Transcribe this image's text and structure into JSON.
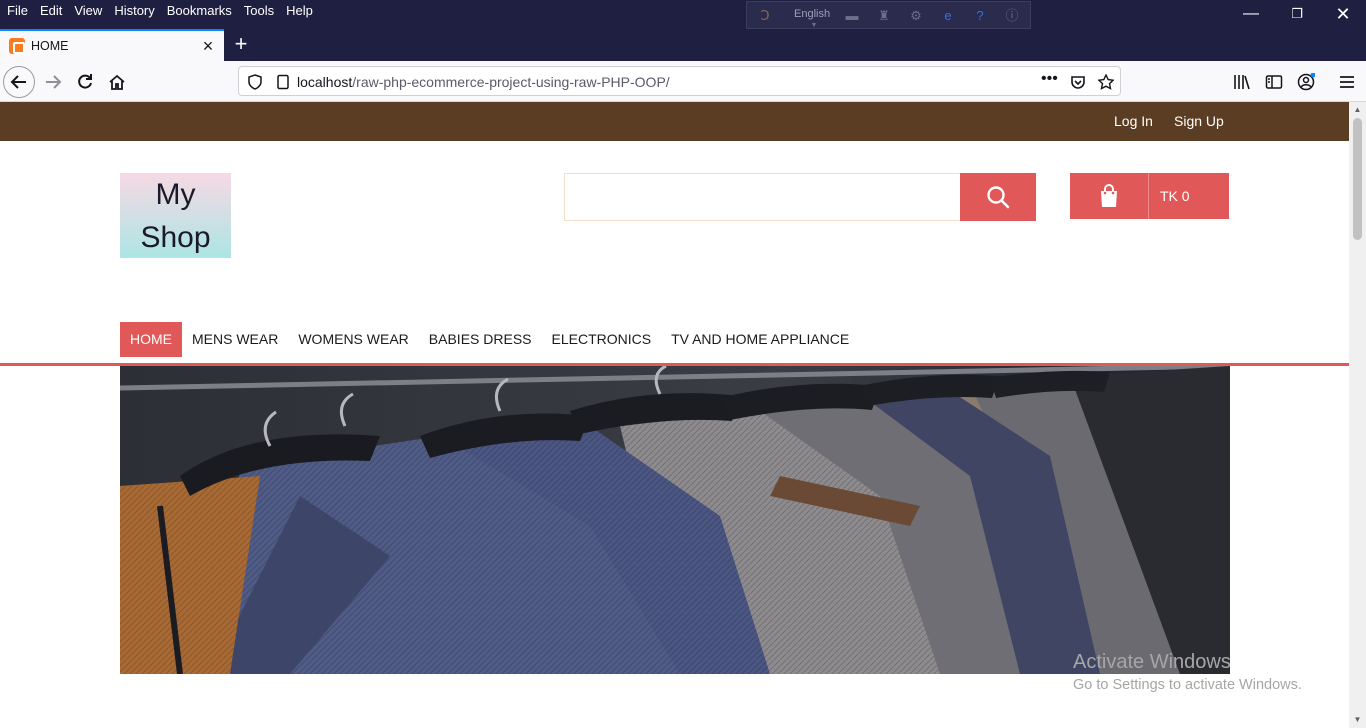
{
  "browser": {
    "menu": [
      "File",
      "Edit",
      "View",
      "History",
      "Bookmarks",
      "Tools",
      "Help"
    ],
    "extension_language": "English",
    "tab_title": "HOME",
    "url_host": "localhost",
    "url_path": "/raw-php-ecommerce-project-using-raw-PHP-OOP/"
  },
  "site": {
    "top_links": {
      "login": "Log In",
      "signup": "Sign Up"
    },
    "logo": {
      "line1": "My",
      "line2": "Shop"
    },
    "search_placeholder": "",
    "cart_total": "TK 0",
    "categories": [
      {
        "label": "HOME",
        "active": true
      },
      {
        "label": "MENS WEAR",
        "active": false
      },
      {
        "label": "WOMENS WEAR",
        "active": false
      },
      {
        "label": "BABIES DRESS",
        "active": false
      },
      {
        "label": "ELECTRONICS",
        "active": false
      },
      {
        "label": "TV AND HOME APPLIANCE",
        "active": false
      }
    ],
    "colors": {
      "brand_red": "#e05858",
      "top_strip": "#5b3d24"
    }
  },
  "os_watermark": {
    "title": "Activate Windows",
    "subtitle": "Go to Settings to activate Windows."
  }
}
